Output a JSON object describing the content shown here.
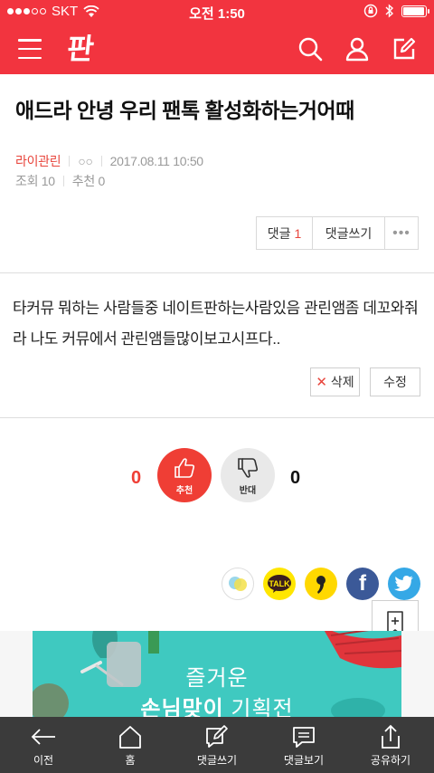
{
  "status_bar": {
    "carrier": "SKT",
    "time": "오전 1:50",
    "signal_bars": 3,
    "battery_level": 0.95
  },
  "header": {
    "logo_text": "판",
    "brand_color": "#f2343f"
  },
  "post": {
    "title": "애드라 안녕 우리 팬톡 활성화하는거어때",
    "author": "라이관린",
    "author_sub": "○○",
    "date": "2017.08.11 10:50",
    "views_label": "조회 10",
    "likes_label": "추천 0",
    "body": "타커뮤 뭐하는 사람들중 네이트판하는사람있음 관린앰좀 데꼬와줘라 나도 커뮤에서 관린앰들많이보고시프다.."
  },
  "comments": {
    "comment_label": "댓글",
    "comment_count": "1",
    "write_label": "댓글쓰기",
    "more_label": "•••"
  },
  "actions": {
    "delete_label": "삭제",
    "edit_label": "수정"
  },
  "votes": {
    "up_count": "0",
    "up_label": "추천",
    "down_count": "0",
    "down_label": "반대",
    "up_color": "#ef3e35"
  },
  "share": {
    "kakao_talk_label": "TALK",
    "story_label": "‚",
    "facebook_label": "f"
  },
  "ad": {
    "line1": "즐거운",
    "line2_bold": "손님맞이",
    "line2_rest": " 기획전"
  },
  "toolbar": {
    "prev_label": "이전",
    "home_label": "홈",
    "write_comment_label": "댓글쓰기",
    "view_comments_label": "댓글보기",
    "share_label": "공유하기"
  }
}
